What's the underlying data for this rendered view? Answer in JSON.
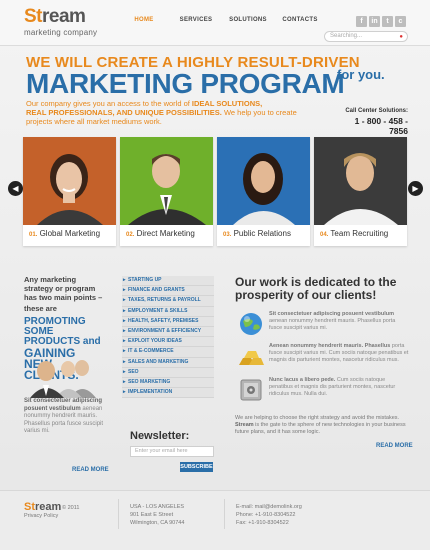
{
  "brand": {
    "logo_prefix": "St",
    "logo_rest": "ream",
    "tagline": "marketing company"
  },
  "nav": [
    {
      "label": "HOME",
      "active": true
    },
    {
      "label": "SERVICES",
      "active": false
    },
    {
      "label": "SOLUTIONS",
      "active": false
    },
    {
      "label": "CONTACTS",
      "active": false
    }
  ],
  "social": [
    "f",
    "in",
    "t",
    "c"
  ],
  "search": {
    "placeholder": "Searching..."
  },
  "hero": {
    "line1": "WE WILL CREATE A HIGHLY RESULT-DRIVEN",
    "line2": "MARKETING PROGRAM",
    "line2_suffix": "for you.",
    "desc_prefix": "Our company gives you an access to the world of ",
    "desc_bold1": "IDEAL SOLUTIONS,",
    "desc_bold2": "REAL PROFESSIONALS, AND UNIQUE POSSIBILITIES.",
    "desc_suffix": " We help you to create projects where all market mediums work."
  },
  "call_center": {
    "label": "Call Center Solutions:",
    "phone": "1 - 800 - 458 - 7856"
  },
  "cards": [
    {
      "num": "01.",
      "label": "Global Marketing",
      "bg": "#c4612a"
    },
    {
      "num": "02.",
      "label": "Direct Marketing",
      "bg": "#6fb02b"
    },
    {
      "num": "03.",
      "label": "Public Relations",
      "bg": "#2b70b5"
    },
    {
      "num": "04.",
      "label": "Team Recruiting",
      "bg": "#3b3b3b"
    }
  ],
  "left": {
    "intro": "Any marketing strategy or program has two main points –",
    "these_are": "these are",
    "promo": "PROMOTING SOME PRODUCTS and",
    "gaining": "GAINING NEW CLIENTS.",
    "small_hl": "Sit consectetuer adipiscing posuent vestibulum",
    "small_text": "aenean nonummy hendrerit mauris. Phasellus porta fusce suscipit varius mi.",
    "more": "READ MORE"
  },
  "menu": [
    "STARTING UP",
    "FINANCE AND GRANTS",
    "TAXES, RETURNS & PAYROLL",
    "EMPLOYMENT & SKILLS",
    "HEALTH, SAFETY, PREMISES",
    "ENVIRONMENT & EFFICIENCY",
    "EXPLOIT YOUR IDEAS",
    "IT & E-COMMERCE",
    "SALES AND MARKETING",
    "SEO",
    "SEO MARKETING",
    "IMPLEMENTATION"
  ],
  "newsletter": {
    "title": "Newsletter:",
    "placeholder": "Enter your email here",
    "button": "SUBSCRIBE"
  },
  "right": {
    "title": "Our work is dedicated to the prosperity of our clients!",
    "items": [
      {
        "hl": "Sit consectetuer adipiscing posuent vestibulum",
        "text": "aenean nonummy hendrerit mauris. Phasellus porta fusce suscipit varius mi."
      },
      {
        "hl": "Aenean nonummy hendrerit mauris. Phasellus",
        "text": "porta fusce suscipit varius mi. Cum sociis natoque penatibus et magnis dis parturient montes, nascetur ridiculus mus."
      },
      {
        "hl": "Nunc lacus a libero pede.",
        "text": "Cum sociis natoque penatibus et magnis dis parturient montes, nascetur ridiculus mus. Nulla dui."
      }
    ],
    "desc_prefix": "We are helping to choose the right strategy and avoid the mistakes. ",
    "desc_hl": "Stream",
    "desc_suffix": " is the gate to the sphere of new technologies in your business future plans, and it has some logic.",
    "more": "READ MORE"
  },
  "footer": {
    "logo_prefix": "St",
    "logo_rest": "ream",
    "copyright": "© 2011",
    "policy": "Privacy Policy",
    "address": [
      "USA - LOS ANGELES",
      "901 East E Street",
      "Wilmington, CA 90744"
    ],
    "contact": [
      "E-mail: mail@demolink.org",
      "Phone: +1-910-8304522",
      "Fax: +1-910-8304522"
    ]
  },
  "colors": {
    "accent": "#e8891d",
    "primary": "#2a6ea8"
  }
}
